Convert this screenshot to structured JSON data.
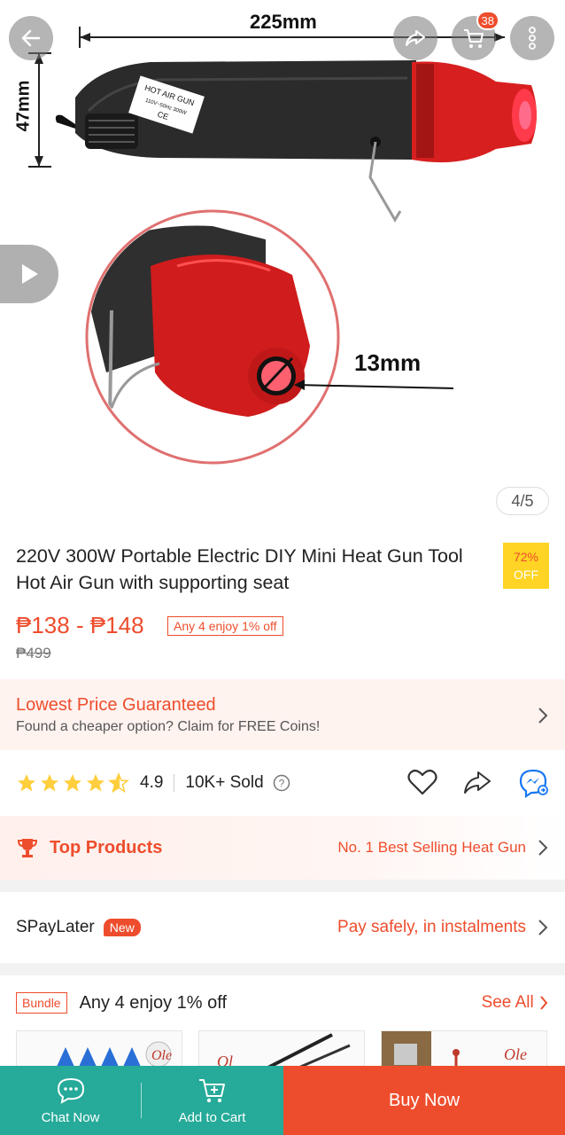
{
  "gallery": {
    "dimension_length": "225mm",
    "dimension_height": "47mm",
    "dimension_nozzle": "13mm",
    "product_label_line1": "HOT AIR GUN",
    "product_label_line2": "110V~50Hz 300W",
    "cart_count": "38",
    "image_counter": "4/5"
  },
  "product": {
    "title": "220V 300W Portable Electric DIY Mini Heat Gun Tool  Hot Air Gun with supporting seat",
    "discount_percent": "72%",
    "discount_label": "OFF",
    "price_range": "₱138 - ₱148",
    "promo_tag": "Any 4 enjoy 1% off",
    "original_price": "₱499"
  },
  "lowest_price": {
    "title": "Lowest Price Guaranteed",
    "subtitle": "Found a cheaper option? Claim for FREE Coins!"
  },
  "rating": {
    "stars": 4.9,
    "value": "4.9",
    "sold": "10K+ Sold"
  },
  "top_products": {
    "label": "Top Products",
    "rank": "No. 1 Best Selling Heat Gun"
  },
  "spaylater": {
    "name": "SPayLater",
    "badge": "New",
    "info": "Pay safely, in instalments"
  },
  "bundle": {
    "tag": "Bundle",
    "title": "Any 4 enjoy 1% off",
    "see_all": "See All"
  },
  "bottom_bar": {
    "chat": "Chat Now",
    "add_to_cart": "Add to Cart",
    "buy_now": "Buy Now"
  },
  "colors": {
    "accent": "#ee4d2d",
    "green": "#26aa99",
    "discount_bg": "#ffd424",
    "star": "#ffce3d"
  }
}
